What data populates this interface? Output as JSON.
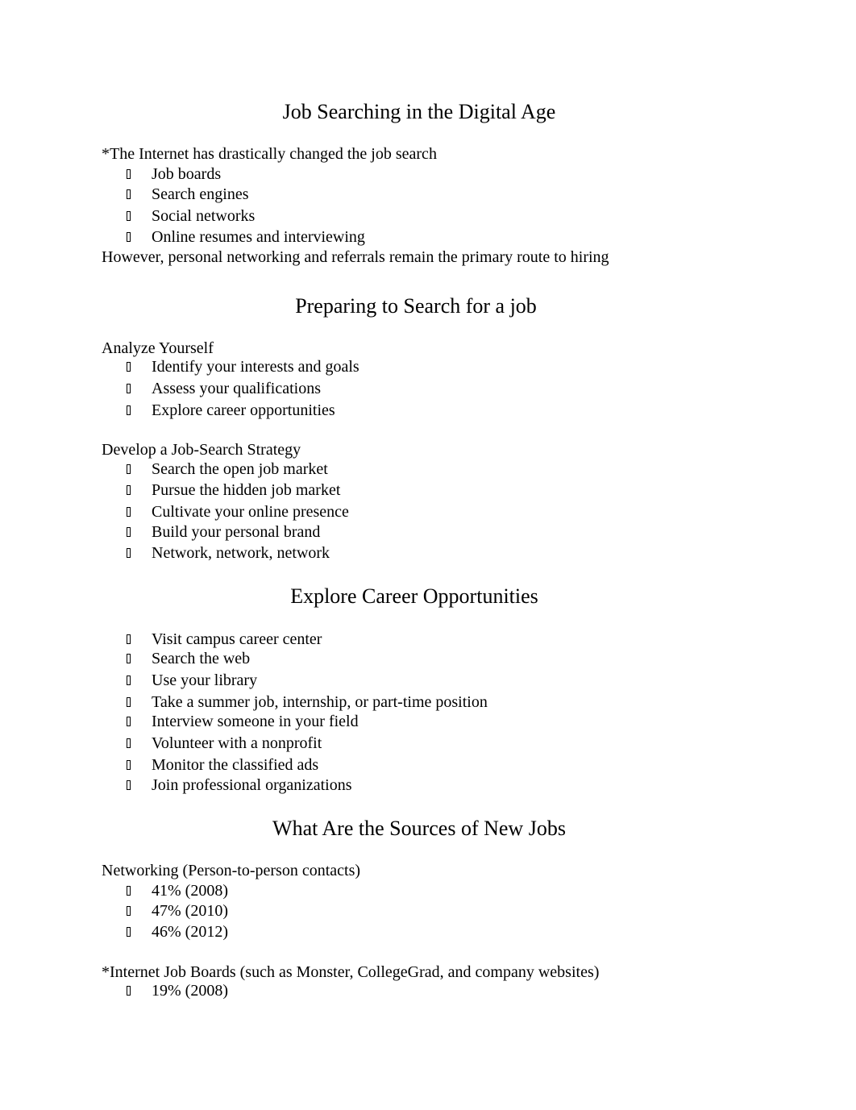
{
  "sections": [
    {
      "heading": "Job Searching in the Digital Age",
      "intro": "*The Internet has drastically changed the job search",
      "items": [
        "Job boards",
        "Search engines",
        "Social networks",
        "Online resumes and interviewing"
      ],
      "outro": "However, personal networking and referrals remain the primary route to hiring"
    },
    {
      "heading": "Preparing to Search for a job",
      "groups": [
        {
          "title": "Analyze Yourself",
          "items": [
            "Identify your interests and goals",
            "Assess your qualifications",
            "Explore career opportunities"
          ]
        },
        {
          "title": "Develop a Job-Search Strategy",
          "items": [
            "Search the open job market",
            "Pursue the hidden job market",
            "Cultivate your online presence",
            "Build your personal brand",
            "Network, network, network"
          ]
        }
      ]
    },
    {
      "heading": "Explore Career Opportunities",
      "items": [
        "Visit campus career center",
        "Search the web",
        "Use your library",
        "Take a summer job, internship, or part-time position",
        "Interview someone in your field",
        "Volunteer with a nonprofit",
        "Monitor the classified ads",
        "Join professional organizations"
      ]
    },
    {
      "heading": "What Are the Sources of New Jobs",
      "groups": [
        {
          "title": "Networking (Person-to-person contacts)",
          "items": [
            "41% (2008)",
            "47% (2010)",
            "46% (2012)"
          ]
        },
        {
          "title": "*Internet Job Boards (such as Monster, CollegeGrad, and company websites)",
          "items": [
            "19% (2008)"
          ]
        }
      ]
    }
  ],
  "bullet_icon": "missing-glyph-box"
}
